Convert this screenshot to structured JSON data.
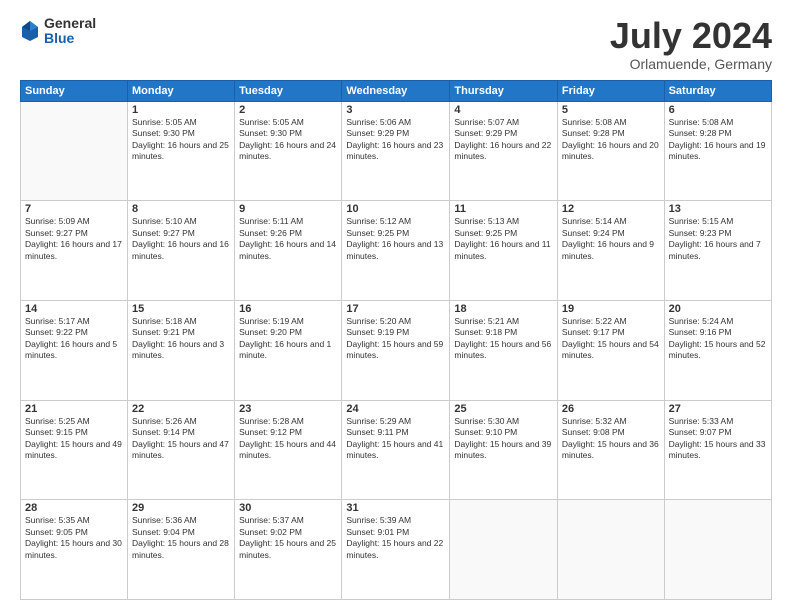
{
  "logo": {
    "general": "General",
    "blue": "Blue"
  },
  "title": "July 2024",
  "subtitle": "Orlamuende, Germany",
  "days_header": [
    "Sunday",
    "Monday",
    "Tuesday",
    "Wednesday",
    "Thursday",
    "Friday",
    "Saturday"
  ],
  "weeks": [
    [
      {
        "num": "",
        "sunrise": "",
        "sunset": "",
        "daylight": ""
      },
      {
        "num": "1",
        "sunrise": "5:05 AM",
        "sunset": "9:30 PM",
        "daylight": "16 hours and 25 minutes."
      },
      {
        "num": "2",
        "sunrise": "5:05 AM",
        "sunset": "9:30 PM",
        "daylight": "16 hours and 24 minutes."
      },
      {
        "num": "3",
        "sunrise": "5:06 AM",
        "sunset": "9:29 PM",
        "daylight": "16 hours and 23 minutes."
      },
      {
        "num": "4",
        "sunrise": "5:07 AM",
        "sunset": "9:29 PM",
        "daylight": "16 hours and 22 minutes."
      },
      {
        "num": "5",
        "sunrise": "5:08 AM",
        "sunset": "9:28 PM",
        "daylight": "16 hours and 20 minutes."
      },
      {
        "num": "6",
        "sunrise": "5:08 AM",
        "sunset": "9:28 PM",
        "daylight": "16 hours and 19 minutes."
      }
    ],
    [
      {
        "num": "7",
        "sunrise": "5:09 AM",
        "sunset": "9:27 PM",
        "daylight": "16 hours and 17 minutes."
      },
      {
        "num": "8",
        "sunrise": "5:10 AM",
        "sunset": "9:27 PM",
        "daylight": "16 hours and 16 minutes."
      },
      {
        "num": "9",
        "sunrise": "5:11 AM",
        "sunset": "9:26 PM",
        "daylight": "16 hours and 14 minutes."
      },
      {
        "num": "10",
        "sunrise": "5:12 AM",
        "sunset": "9:25 PM",
        "daylight": "16 hours and 13 minutes."
      },
      {
        "num": "11",
        "sunrise": "5:13 AM",
        "sunset": "9:25 PM",
        "daylight": "16 hours and 11 minutes."
      },
      {
        "num": "12",
        "sunrise": "5:14 AM",
        "sunset": "9:24 PM",
        "daylight": "16 hours and 9 minutes."
      },
      {
        "num": "13",
        "sunrise": "5:15 AM",
        "sunset": "9:23 PM",
        "daylight": "16 hours and 7 minutes."
      }
    ],
    [
      {
        "num": "14",
        "sunrise": "5:17 AM",
        "sunset": "9:22 PM",
        "daylight": "16 hours and 5 minutes."
      },
      {
        "num": "15",
        "sunrise": "5:18 AM",
        "sunset": "9:21 PM",
        "daylight": "16 hours and 3 minutes."
      },
      {
        "num": "16",
        "sunrise": "5:19 AM",
        "sunset": "9:20 PM",
        "daylight": "16 hours and 1 minute."
      },
      {
        "num": "17",
        "sunrise": "5:20 AM",
        "sunset": "9:19 PM",
        "daylight": "15 hours and 59 minutes."
      },
      {
        "num": "18",
        "sunrise": "5:21 AM",
        "sunset": "9:18 PM",
        "daylight": "15 hours and 56 minutes."
      },
      {
        "num": "19",
        "sunrise": "5:22 AM",
        "sunset": "9:17 PM",
        "daylight": "15 hours and 54 minutes."
      },
      {
        "num": "20",
        "sunrise": "5:24 AM",
        "sunset": "9:16 PM",
        "daylight": "15 hours and 52 minutes."
      }
    ],
    [
      {
        "num": "21",
        "sunrise": "5:25 AM",
        "sunset": "9:15 PM",
        "daylight": "15 hours and 49 minutes."
      },
      {
        "num": "22",
        "sunrise": "5:26 AM",
        "sunset": "9:14 PM",
        "daylight": "15 hours and 47 minutes."
      },
      {
        "num": "23",
        "sunrise": "5:28 AM",
        "sunset": "9:12 PM",
        "daylight": "15 hours and 44 minutes."
      },
      {
        "num": "24",
        "sunrise": "5:29 AM",
        "sunset": "9:11 PM",
        "daylight": "15 hours and 41 minutes."
      },
      {
        "num": "25",
        "sunrise": "5:30 AM",
        "sunset": "9:10 PM",
        "daylight": "15 hours and 39 minutes."
      },
      {
        "num": "26",
        "sunrise": "5:32 AM",
        "sunset": "9:08 PM",
        "daylight": "15 hours and 36 minutes."
      },
      {
        "num": "27",
        "sunrise": "5:33 AM",
        "sunset": "9:07 PM",
        "daylight": "15 hours and 33 minutes."
      }
    ],
    [
      {
        "num": "28",
        "sunrise": "5:35 AM",
        "sunset": "9:05 PM",
        "daylight": "15 hours and 30 minutes."
      },
      {
        "num": "29",
        "sunrise": "5:36 AM",
        "sunset": "9:04 PM",
        "daylight": "15 hours and 28 minutes."
      },
      {
        "num": "30",
        "sunrise": "5:37 AM",
        "sunset": "9:02 PM",
        "daylight": "15 hours and 25 minutes."
      },
      {
        "num": "31",
        "sunrise": "5:39 AM",
        "sunset": "9:01 PM",
        "daylight": "15 hours and 22 minutes."
      },
      {
        "num": "",
        "sunrise": "",
        "sunset": "",
        "daylight": ""
      },
      {
        "num": "",
        "sunrise": "",
        "sunset": "",
        "daylight": ""
      },
      {
        "num": "",
        "sunrise": "",
        "sunset": "",
        "daylight": ""
      }
    ]
  ]
}
